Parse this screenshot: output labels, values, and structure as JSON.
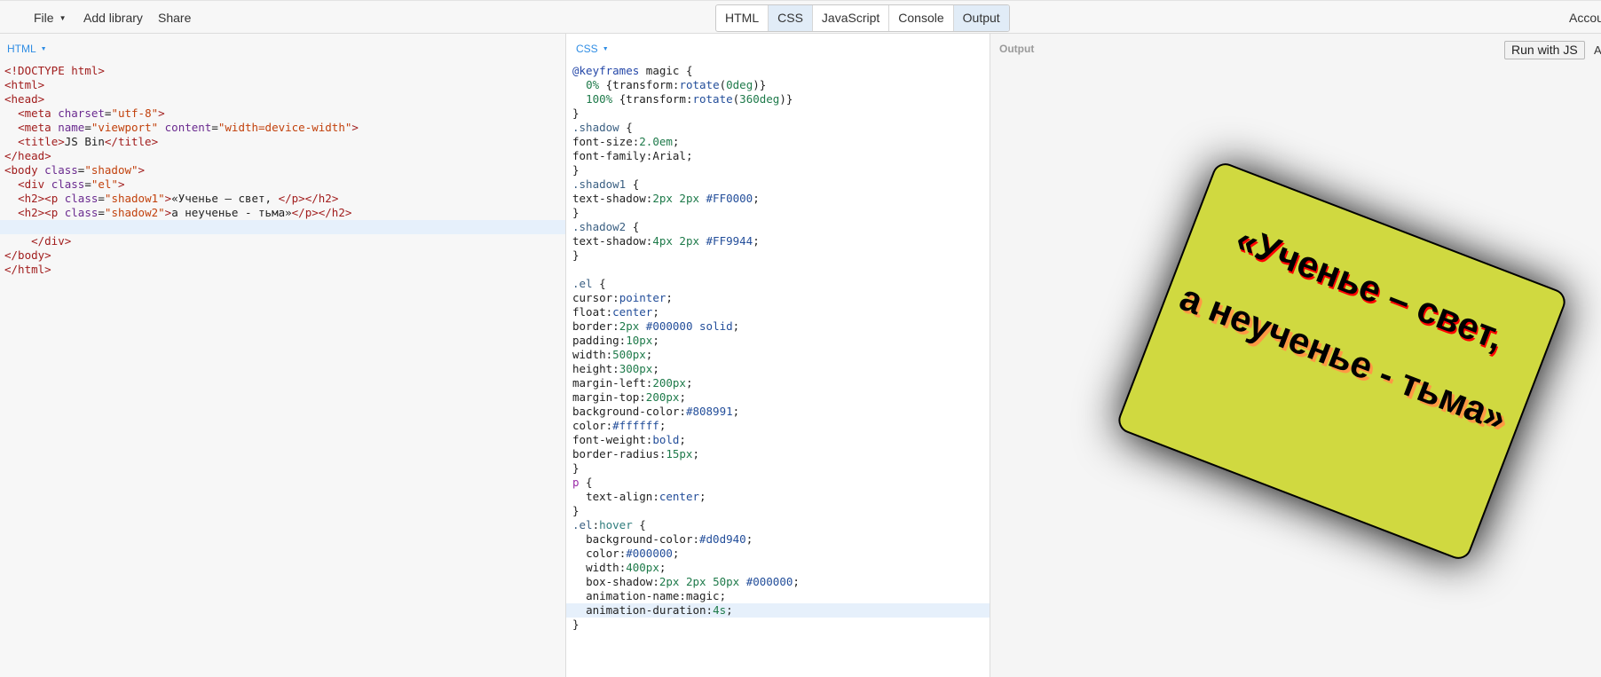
{
  "topbar": {
    "menus": [
      {
        "label": "File",
        "has_caret": true
      },
      {
        "label": "Add library",
        "has_caret": false
      },
      {
        "label": "Share",
        "has_caret": false
      }
    ],
    "panel_toggles": [
      {
        "label": "HTML",
        "active": false
      },
      {
        "label": "CSS",
        "active": true
      },
      {
        "label": "JavaScript",
        "active": false
      },
      {
        "label": "Console",
        "active": false
      },
      {
        "label": "Output",
        "active": true
      }
    ],
    "account_label": "Accou"
  },
  "html_panel": {
    "label": "HTML",
    "lines": [
      {
        "hl": false,
        "tokens": [
          [
            "tag",
            "<!DOCTYPE html>"
          ]
        ]
      },
      {
        "hl": false,
        "tokens": [
          [
            "tag",
            "<html>"
          ]
        ]
      },
      {
        "hl": false,
        "tokens": [
          [
            "tag",
            "<head>"
          ]
        ]
      },
      {
        "hl": false,
        "tokens": [
          [
            "plain",
            "  "
          ],
          [
            "tag",
            "<meta "
          ],
          [
            "attr",
            "charset"
          ],
          [
            "plain",
            "="
          ],
          [
            "str",
            "\"utf-8\""
          ],
          [
            "tag",
            ">"
          ]
        ]
      },
      {
        "hl": false,
        "tokens": [
          [
            "plain",
            "  "
          ],
          [
            "tag",
            "<meta "
          ],
          [
            "attr",
            "name"
          ],
          [
            "plain",
            "="
          ],
          [
            "str",
            "\"viewport\""
          ],
          [
            "plain",
            " "
          ],
          [
            "attr",
            "content"
          ],
          [
            "plain",
            "="
          ],
          [
            "str",
            "\"width=device-width\""
          ],
          [
            "tag",
            ">"
          ]
        ]
      },
      {
        "hl": false,
        "tokens": [
          [
            "plain",
            "  "
          ],
          [
            "tag",
            "<title>"
          ],
          [
            "plain",
            "JS Bin"
          ],
          [
            "tag",
            "</title>"
          ]
        ]
      },
      {
        "hl": false,
        "tokens": [
          [
            "tag",
            "</head>"
          ]
        ]
      },
      {
        "hl": false,
        "tokens": [
          [
            "tag",
            "<body "
          ],
          [
            "attr",
            "class"
          ],
          [
            "plain",
            "="
          ],
          [
            "str",
            "\"shadow\""
          ],
          [
            "tag",
            ">"
          ]
        ]
      },
      {
        "hl": false,
        "tokens": [
          [
            "plain",
            "  "
          ],
          [
            "tag",
            "<div "
          ],
          [
            "attr",
            "class"
          ],
          [
            "plain",
            "="
          ],
          [
            "str",
            "\"el\""
          ],
          [
            "tag",
            ">"
          ]
        ]
      },
      {
        "hl": false,
        "tokens": [
          [
            "plain",
            "  "
          ],
          [
            "tag",
            "<h2><p "
          ],
          [
            "attr",
            "class"
          ],
          [
            "plain",
            "="
          ],
          [
            "str",
            "\"shadow1\""
          ],
          [
            "tag",
            ">"
          ],
          [
            "plain",
            "«Ученье – свет, "
          ],
          [
            "tag",
            "</p></h2>"
          ]
        ]
      },
      {
        "hl": false,
        "tokens": [
          [
            "plain",
            "  "
          ],
          [
            "tag",
            "<h2><p "
          ],
          [
            "attr",
            "class"
          ],
          [
            "plain",
            "="
          ],
          [
            "str",
            "\"shadow2\""
          ],
          [
            "tag",
            ">"
          ],
          [
            "plain",
            "а неученье - тьма»"
          ],
          [
            "tag",
            "</p></h2>"
          ]
        ]
      },
      {
        "hl": true,
        "tokens": [
          [
            "plain",
            " "
          ]
        ]
      },
      {
        "hl": false,
        "tokens": [
          [
            "plain",
            "    "
          ],
          [
            "tag",
            "</div>"
          ]
        ]
      },
      {
        "hl": false,
        "tokens": [
          [
            "tag",
            "</body>"
          ]
        ]
      },
      {
        "hl": false,
        "tokens": [
          [
            "tag",
            "</html>"
          ]
        ]
      }
    ]
  },
  "css_panel": {
    "label": "CSS",
    "lines": [
      {
        "hl": false,
        "tokens": [
          [
            "at",
            "@keyframes"
          ],
          [
            "plain",
            " magic {"
          ]
        ]
      },
      {
        "hl": false,
        "tokens": [
          [
            "plain",
            "  "
          ],
          [
            "num",
            "0%"
          ],
          [
            "plain",
            " {transform:"
          ],
          [
            "kw",
            "rotate"
          ],
          [
            "plain",
            "("
          ],
          [
            "num",
            "0deg"
          ],
          [
            "plain",
            ")}"
          ]
        ]
      },
      {
        "hl": false,
        "tokens": [
          [
            "plain",
            "  "
          ],
          [
            "num",
            "100%"
          ],
          [
            "plain",
            " {transform:"
          ],
          [
            "kw",
            "rotate"
          ],
          [
            "plain",
            "("
          ],
          [
            "num",
            "360deg"
          ],
          [
            "plain",
            ")}"
          ]
        ]
      },
      {
        "hl": false,
        "tokens": [
          [
            "plain",
            "}"
          ]
        ]
      },
      {
        "hl": false,
        "tokens": [
          [
            "sel",
            ".shadow"
          ],
          [
            "plain",
            " {"
          ]
        ]
      },
      {
        "hl": false,
        "tokens": [
          [
            "prop",
            "font-size:"
          ],
          [
            "num",
            "2.0em"
          ],
          [
            "plain",
            ";"
          ]
        ]
      },
      {
        "hl": false,
        "tokens": [
          [
            "prop",
            "font-family:"
          ],
          [
            "plain",
            "Arial;"
          ]
        ]
      },
      {
        "hl": false,
        "tokens": [
          [
            "plain",
            "}"
          ]
        ]
      },
      {
        "hl": false,
        "tokens": [
          [
            "sel",
            ".shadow1"
          ],
          [
            "plain",
            " {"
          ]
        ]
      },
      {
        "hl": false,
        "tokens": [
          [
            "prop",
            "text-shadow:"
          ],
          [
            "num",
            "2px 2px"
          ],
          [
            "plain",
            " "
          ],
          [
            "hex",
            "#FF0000"
          ],
          [
            "plain",
            ";"
          ]
        ]
      },
      {
        "hl": false,
        "tokens": [
          [
            "plain",
            "}"
          ]
        ]
      },
      {
        "hl": false,
        "tokens": [
          [
            "sel",
            ".shadow2"
          ],
          [
            "plain",
            " {"
          ]
        ]
      },
      {
        "hl": false,
        "tokens": [
          [
            "prop",
            "text-shadow:"
          ],
          [
            "num",
            "4px 2px"
          ],
          [
            "plain",
            " "
          ],
          [
            "hex",
            "#FF9944"
          ],
          [
            "plain",
            ";"
          ]
        ]
      },
      {
        "hl": false,
        "tokens": [
          [
            "plain",
            "}"
          ]
        ]
      },
      {
        "hl": false,
        "tokens": [
          [
            "plain",
            ""
          ]
        ]
      },
      {
        "hl": false,
        "tokens": [
          [
            "sel",
            ".el"
          ],
          [
            "plain",
            " {"
          ]
        ]
      },
      {
        "hl": false,
        "tokens": [
          [
            "prop",
            "cursor:"
          ],
          [
            "kw",
            "pointer"
          ],
          [
            "plain",
            ";"
          ]
        ]
      },
      {
        "hl": false,
        "tokens": [
          [
            "prop",
            "float:"
          ],
          [
            "kw",
            "center"
          ],
          [
            "plain",
            ";"
          ]
        ]
      },
      {
        "hl": false,
        "tokens": [
          [
            "prop",
            "border:"
          ],
          [
            "num",
            "2px"
          ],
          [
            "plain",
            " "
          ],
          [
            "hex",
            "#000000"
          ],
          [
            "plain",
            " "
          ],
          [
            "kw",
            "solid"
          ],
          [
            "plain",
            ";"
          ]
        ]
      },
      {
        "hl": false,
        "tokens": [
          [
            "prop",
            "padding:"
          ],
          [
            "num",
            "10px"
          ],
          [
            "plain",
            ";"
          ]
        ]
      },
      {
        "hl": false,
        "tokens": [
          [
            "prop",
            "width:"
          ],
          [
            "num",
            "500px"
          ],
          [
            "plain",
            ";"
          ]
        ]
      },
      {
        "hl": false,
        "tokens": [
          [
            "prop",
            "height:"
          ],
          [
            "num",
            "300px"
          ],
          [
            "plain",
            ";"
          ]
        ]
      },
      {
        "hl": false,
        "tokens": [
          [
            "prop",
            "margin-left:"
          ],
          [
            "num",
            "200px"
          ],
          [
            "plain",
            ";"
          ]
        ]
      },
      {
        "hl": false,
        "tokens": [
          [
            "prop",
            "margin-top:"
          ],
          [
            "num",
            "200px"
          ],
          [
            "plain",
            ";"
          ]
        ]
      },
      {
        "hl": false,
        "tokens": [
          [
            "prop",
            "background-color:"
          ],
          [
            "hex",
            "#808991"
          ],
          [
            "plain",
            ";"
          ]
        ]
      },
      {
        "hl": false,
        "tokens": [
          [
            "prop",
            "color:"
          ],
          [
            "hex",
            "#ffffff"
          ],
          [
            "plain",
            ";"
          ]
        ]
      },
      {
        "hl": false,
        "tokens": [
          [
            "prop",
            "font-weight:"
          ],
          [
            "kw",
            "bold"
          ],
          [
            "plain",
            ";"
          ]
        ]
      },
      {
        "hl": false,
        "tokens": [
          [
            "prop",
            "border-radius:"
          ],
          [
            "num",
            "15px"
          ],
          [
            "plain",
            ";"
          ]
        ]
      },
      {
        "hl": false,
        "tokens": [
          [
            "plain",
            "}"
          ]
        ]
      },
      {
        "hl": false,
        "tokens": [
          [
            "elem",
            "p"
          ],
          [
            "plain",
            " {"
          ]
        ]
      },
      {
        "hl": false,
        "tokens": [
          [
            "plain",
            "  "
          ],
          [
            "prop",
            "text-align:"
          ],
          [
            "kw",
            "center"
          ],
          [
            "plain",
            ";"
          ]
        ]
      },
      {
        "hl": false,
        "tokens": [
          [
            "plain",
            "}"
          ]
        ]
      },
      {
        "hl": false,
        "tokens": [
          [
            "sel",
            ".el"
          ],
          [
            "plain",
            ":"
          ],
          [
            "pseudo",
            "hover"
          ],
          [
            "plain",
            " {"
          ]
        ]
      },
      {
        "hl": false,
        "tokens": [
          [
            "plain",
            "  "
          ],
          [
            "prop",
            "background-color:"
          ],
          [
            "hex",
            "#d0d940"
          ],
          [
            "plain",
            ";"
          ]
        ]
      },
      {
        "hl": false,
        "tokens": [
          [
            "plain",
            "  "
          ],
          [
            "prop",
            "color:"
          ],
          [
            "hex",
            "#000000"
          ],
          [
            "plain",
            ";"
          ]
        ]
      },
      {
        "hl": false,
        "tokens": [
          [
            "plain",
            "  "
          ],
          [
            "prop",
            "width:"
          ],
          [
            "num",
            "400px"
          ],
          [
            "plain",
            ";"
          ]
        ]
      },
      {
        "hl": false,
        "tokens": [
          [
            "plain",
            "  "
          ],
          [
            "prop",
            "box-shadow:"
          ],
          [
            "num",
            "2px 2px 50px"
          ],
          [
            "plain",
            " "
          ],
          [
            "hex",
            "#000000"
          ],
          [
            "plain",
            ";"
          ]
        ]
      },
      {
        "hl": false,
        "tokens": [
          [
            "plain",
            "  "
          ],
          [
            "prop",
            "animation-name:"
          ],
          [
            "plain",
            "magic;"
          ]
        ]
      },
      {
        "hl": true,
        "tokens": [
          [
            "plain",
            "  "
          ],
          [
            "prop",
            "animation-duration:"
          ],
          [
            "num",
            "4s"
          ],
          [
            "plain",
            ";"
          ]
        ]
      },
      {
        "hl": false,
        "tokens": [
          [
            "plain",
            "}"
          ]
        ]
      }
    ]
  },
  "output_panel": {
    "label": "Output",
    "run_button": "Run with JS",
    "auto_label": "A",
    "demo": {
      "line1": "«Ученье – свет,",
      "line2": "а неученье - тьма»",
      "bg_color": "#d0d940"
    }
  },
  "colors": {
    "accent": "#2f8de4",
    "active_toggle": "#e1ecf7",
    "highlight_line": "#e6f0fb",
    "shadow1": "#ff0000",
    "shadow2": "#ff9944"
  }
}
